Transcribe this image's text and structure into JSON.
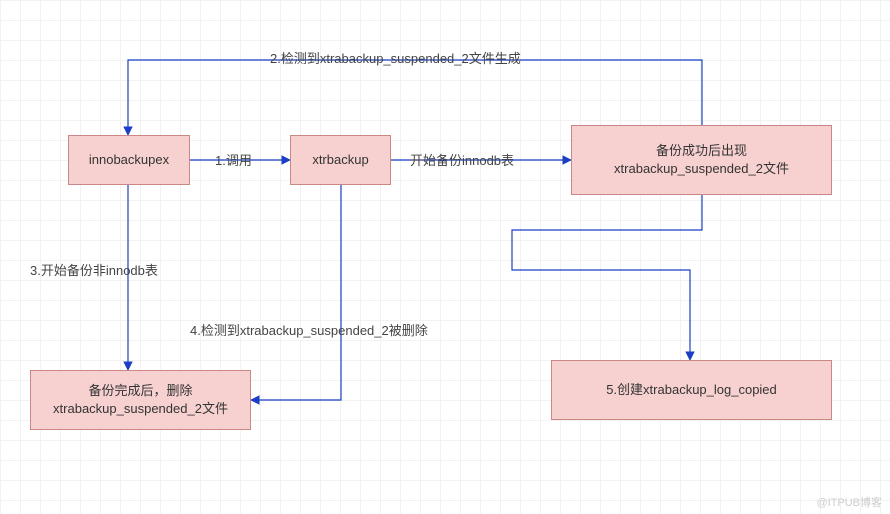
{
  "nodes": {
    "innobackupex": "innobackupex",
    "xtrbackup": "xtrbackup",
    "backup_success": "备份成功后出现\nxtrabackup_suspended_2文件",
    "backup_done_delete": "备份完成后，删除\nxtrabackup_suspended_2文件",
    "log_copied": "5.创建xtrabackup_log_copied"
  },
  "edges": {
    "call": "1.调用",
    "start_backup_innodb": "开始备份innodb表",
    "detect_generated": "2.检测到xtrabackup_suspended_2文件生成",
    "start_backup_non_innodb": "3.开始备份非innodb表",
    "detect_deleted": "4.检测到xtrabackup_suspended_2被删除"
  },
  "watermark": "@ITPUB博客"
}
